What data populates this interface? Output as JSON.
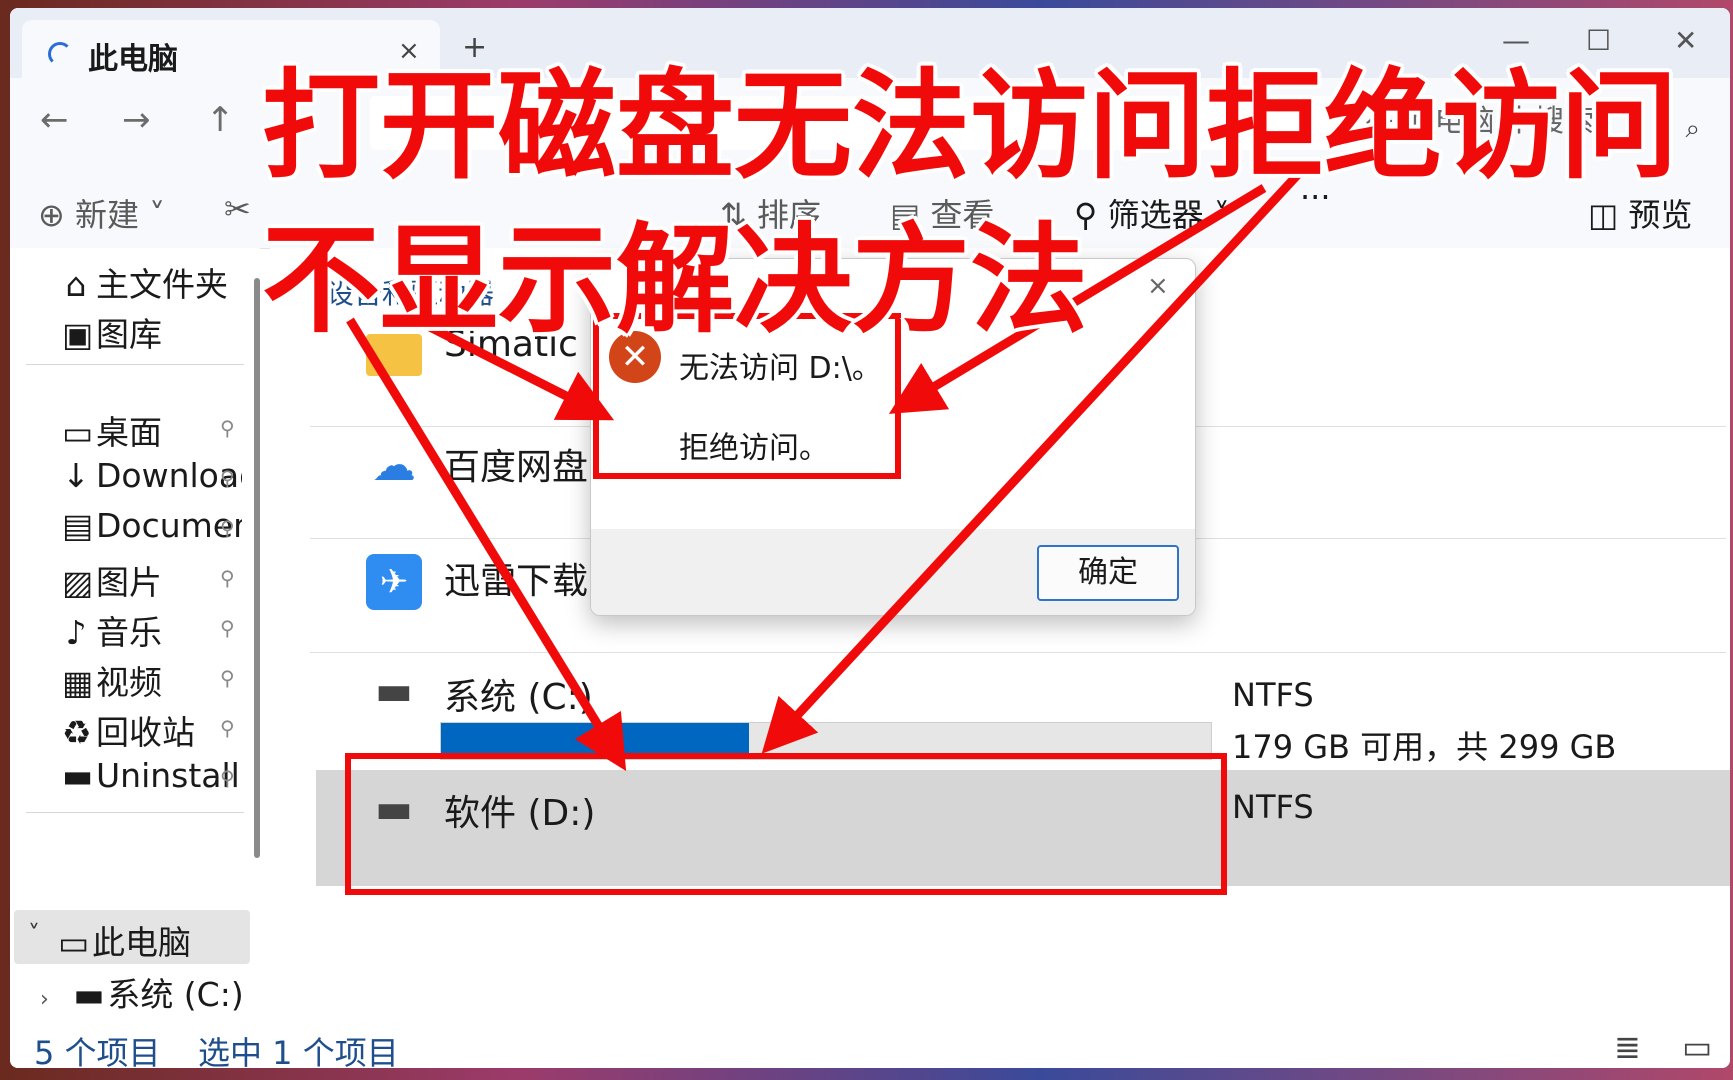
{
  "tab": {
    "title": "此电脑",
    "close": "×",
    "new_tab": "+"
  },
  "window_buttons": {
    "minimize": "—",
    "maximize": "☐",
    "close": "✕"
  },
  "nav": {
    "back": "←",
    "forward": "→",
    "up": "↑",
    "address_fragment": "在 此电脑 中搜索"
  },
  "toolbar": {
    "new_label": "新建",
    "cut": "✂",
    "sort": "排序",
    "view": "查看",
    "filter": "筛选器",
    "more": "···",
    "preview": "预览"
  },
  "sidebar": {
    "home": "主文件夹",
    "gallery": "图库",
    "items": [
      {
        "label": "桌面",
        "icon": "desktop-icon"
      },
      {
        "label": "Downloads",
        "icon": "download-icon"
      },
      {
        "label": "Documents",
        "icon": "document-icon"
      },
      {
        "label": "图片",
        "icon": "pictures-icon"
      },
      {
        "label": "音乐",
        "icon": "music-icon"
      },
      {
        "label": "视频",
        "icon": "video-icon"
      },
      {
        "label": "回收站",
        "icon": "recycle-icon"
      },
      {
        "label": "Uninstall",
        "icon": "folder-icon"
      }
    ],
    "this_pc": "此电脑",
    "c_drive": "系统 (C:)"
  },
  "content": {
    "section_header": "设备和驱动器",
    "rows": [
      {
        "name": "Simatic S",
        "icon": "folder-icon"
      },
      {
        "name": "百度网盘",
        "icon": "baidu-netdisk-icon"
      },
      {
        "name": "迅雷下载",
        "icon": "xunlei-icon"
      }
    ],
    "drive_c": {
      "name": "系统 (C:)",
      "fs": "NTFS",
      "space": "179 GB 可用，共 299 GB",
      "used_fraction": 0.4
    },
    "drive_d": {
      "name": "软件 (D:)",
      "fs": "NTFS"
    }
  },
  "status": {
    "count": "5 个项目",
    "selected": "选中 1 个项目"
  },
  "dialog": {
    "message": "无法访问 D:\\。",
    "detail": "拒绝访问。",
    "ok": "确定",
    "close": "×"
  },
  "overlay": {
    "line1": "打开磁盘无法访问拒绝访问",
    "line2": "不显示解决方法",
    "accent_color": "#f00a0a"
  }
}
